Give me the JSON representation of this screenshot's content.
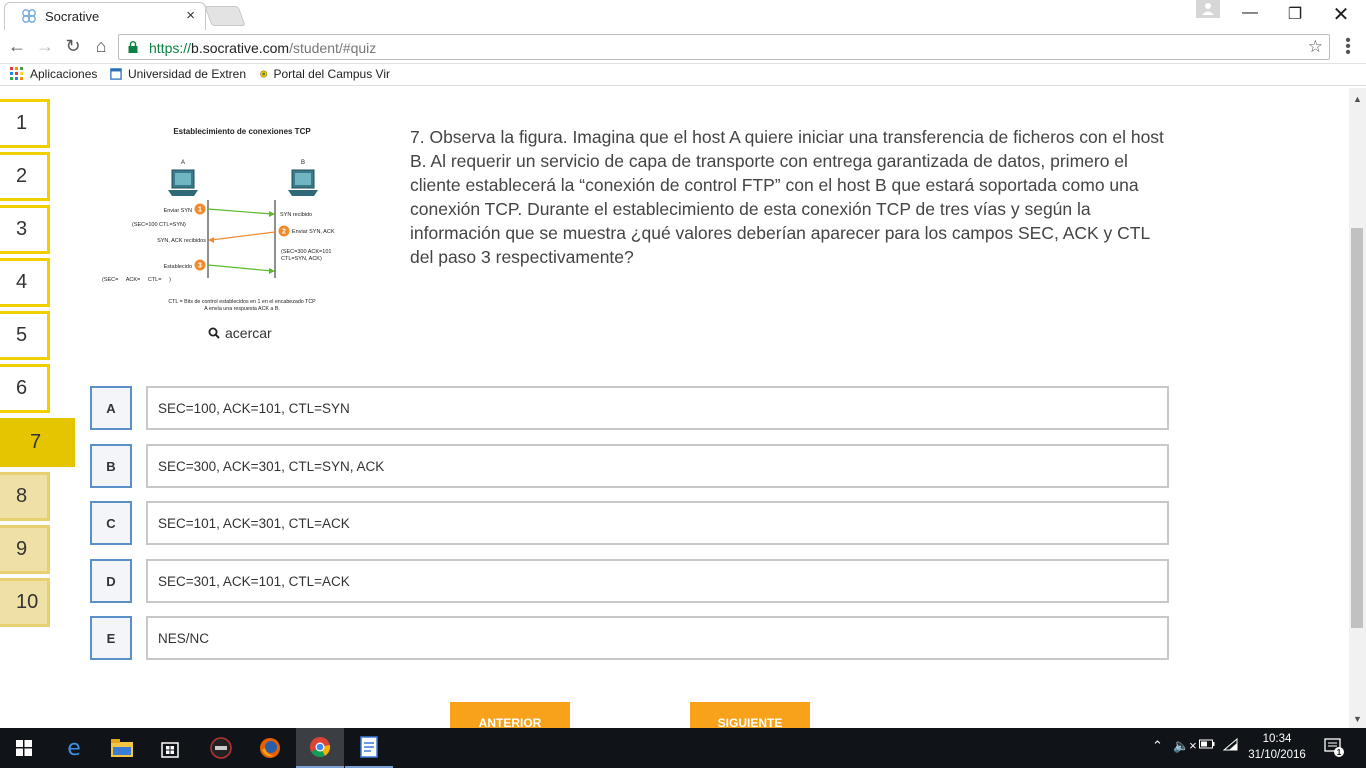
{
  "browser": {
    "tab_title": "Socrative",
    "tab_close": "×",
    "url_scheme": "https://",
    "url_host": "b.socrative.com",
    "url_path": "/student/#quiz",
    "bookmarks": [
      {
        "label": "Aplicaciones",
        "icon": "apps-grid-icon"
      },
      {
        "label": "Universidad de Extren",
        "icon": "page-icon"
      },
      {
        "label": "Portal del Campus Vir",
        "icon": "globe-icon"
      }
    ]
  },
  "quiz": {
    "questions": [
      "1",
      "2",
      "3",
      "4",
      "5",
      "6",
      "7",
      "8",
      "9",
      "10"
    ],
    "current": "7",
    "question_text": "7. Observa la figura. Imagina que el host A quiere iniciar una transferencia de ficheros con el host B. Al requerir un servicio de capa de transporte con entrega garantizada de datos, primero el cliente establecerá la “conexión de control FTP” con el host B que estará soportada como una conexión TCP. Durante el establecimiento de esta conexión TCP de tres vías y según la información que se muestra ¿qué valores deberían aparecer para los campos SEC, ACK y CTL del paso 3 respectivamente?",
    "zoom_label": "acercar",
    "figure": {
      "title": "Establecimiento de conexiones TCP",
      "host_a": "A",
      "host_b": "B",
      "step1_label": "Enviar SYN",
      "step1_fields": "(SEC=100 CTL=SYN)",
      "syn_received": "SYN recibido",
      "step2_label": "Enviar SYN, ACK",
      "synack_received": "SYN, ACK recibidos",
      "step2_fields_1": "(SEC=300 ACK=101",
      "step2_fields_2": "CTL=SYN, ACK)",
      "step3_label": "Establecido",
      "step3_fields": "(SEC=     ACK=     CTL=     )",
      "footnote_1": "CTL = Bits de control establecidos en 1 en el encabezado TCP",
      "footnote_2": "A envía una respuesta ACK a B.",
      "num1": "1",
      "num2": "2",
      "num3": "3"
    },
    "answers": [
      {
        "letter": "A",
        "text": "SEC=100, ACK=101, CTL=SYN"
      },
      {
        "letter": "B",
        "text": "SEC=300, ACK=301, CTL=SYN, ACK"
      },
      {
        "letter": "C",
        "text": "SEC=101, ACK=301, CTL=ACK"
      },
      {
        "letter": "D",
        "text": "SEC=301, ACK=101, CTL=ACK"
      },
      {
        "letter": "E",
        "text": "NES/NC"
      }
    ],
    "prev_label": "ANTERIOR",
    "next_label": "SIGUIENTE"
  },
  "taskbar": {
    "time": "10:34",
    "date": "31/10/2016",
    "notification_count": "1"
  },
  "colors": {
    "accent_yellow": "#f0d000",
    "orange": "#f7a21a",
    "answer_blue": "#5b8fc7"
  }
}
